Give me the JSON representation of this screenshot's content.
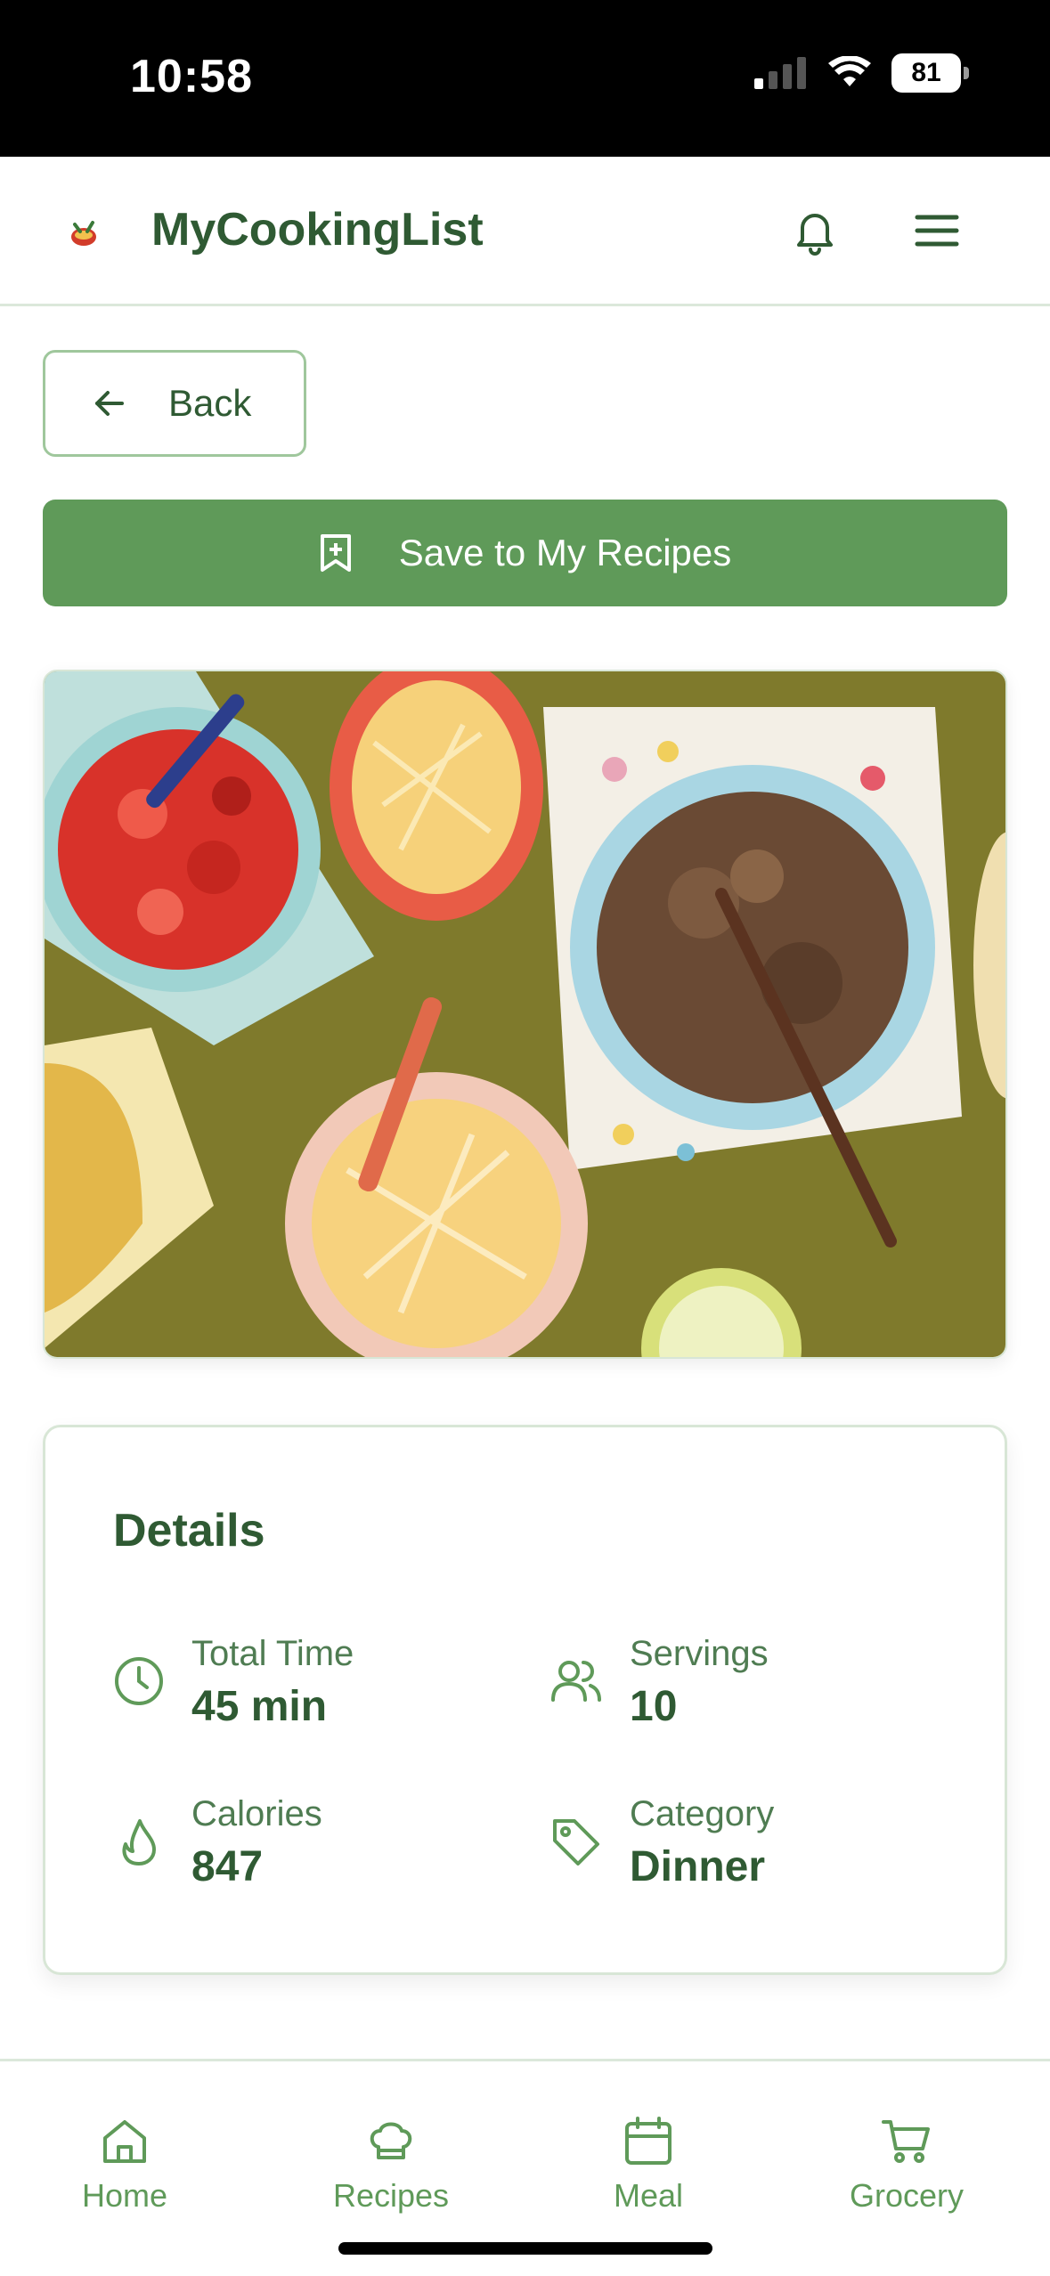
{
  "status_bar": {
    "time": "10:58",
    "battery": "81"
  },
  "header": {
    "brand": "MyCookingList"
  },
  "actions": {
    "back_label": "Back",
    "save_label": "Save to My Recipes"
  },
  "details": {
    "title": "Details",
    "items": [
      {
        "label": "Total Time",
        "value": "45 min",
        "icon": "clock-icon"
      },
      {
        "label": "Servings",
        "value": "10",
        "icon": "users-icon"
      },
      {
        "label": "Calories",
        "value": "847",
        "icon": "flame-icon"
      },
      {
        "label": "Category",
        "value": "Dinner",
        "icon": "tag-icon"
      }
    ]
  },
  "nav": {
    "items": [
      {
        "label": "Home",
        "icon": "home-icon"
      },
      {
        "label": "Recipes",
        "icon": "chef-hat-icon"
      },
      {
        "label": "Meal",
        "icon": "calendar-icon"
      },
      {
        "label": "Grocery",
        "icon": "cart-icon"
      }
    ]
  },
  "colors": {
    "accent": "#5f9a59",
    "text": "#2f5a33",
    "border": "#d8e6d6"
  }
}
